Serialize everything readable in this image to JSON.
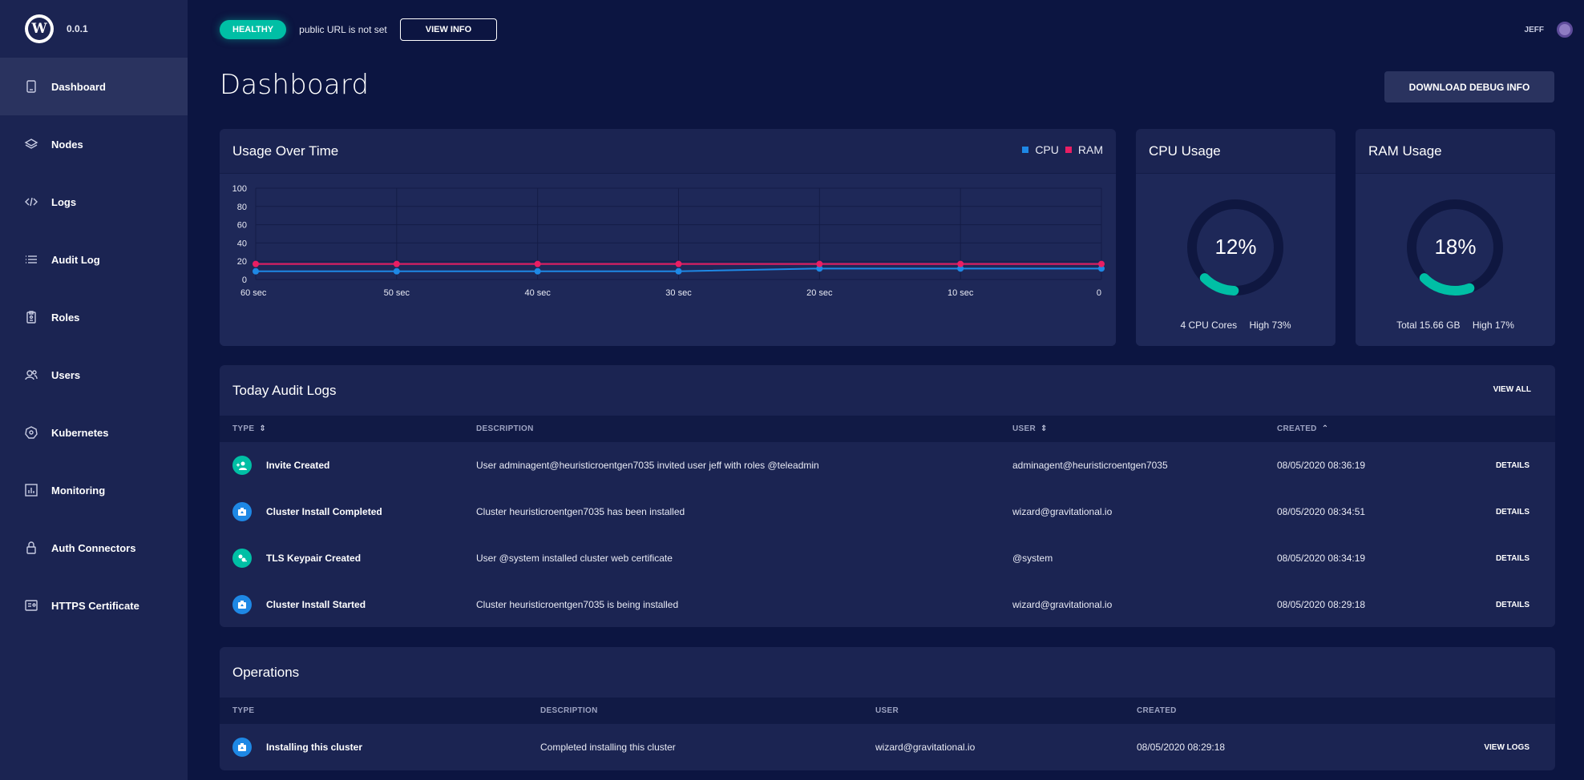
{
  "app": {
    "version": "0.0.1"
  },
  "sidebar": {
    "items": [
      {
        "label": "Dashboard",
        "icon": "tablet-icon"
      },
      {
        "label": "Nodes",
        "icon": "layers-icon"
      },
      {
        "label": "Logs",
        "icon": "code-icon"
      },
      {
        "label": "Audit Log",
        "icon": "list-icon"
      },
      {
        "label": "Roles",
        "icon": "clipboard-icon"
      },
      {
        "label": "Users",
        "icon": "users-icon"
      },
      {
        "label": "Kubernetes",
        "icon": "kubernetes-icon"
      },
      {
        "label": "Monitoring",
        "icon": "bar-chart-icon"
      },
      {
        "label": "Auth Connectors",
        "icon": "lock-icon"
      },
      {
        "label": "HTTPS Certificate",
        "icon": "certificate-icon"
      }
    ]
  },
  "topbar": {
    "status": "HEALTHY",
    "url_text": "public URL is not set",
    "view_info": "VIEW INFO",
    "user": "JEFF"
  },
  "page": {
    "title": "Dashboard",
    "debug_button": "DOWNLOAD DEBUG INFO"
  },
  "usage_card": {
    "title": "Usage Over Time",
    "legend": [
      {
        "name": "CPU",
        "color": "#1e88e5"
      },
      {
        "name": "RAM",
        "color": "#e91e63"
      }
    ]
  },
  "chart_data": {
    "type": "line",
    "x": [
      "60 sec",
      "50 sec",
      "40 sec",
      "30 sec",
      "20 sec",
      "10 sec",
      "0"
    ],
    "series": [
      {
        "name": "CPU",
        "color": "#1e88e5",
        "values": [
          9,
          9,
          9,
          9,
          12,
          12,
          12
        ]
      },
      {
        "name": "RAM",
        "color": "#e91e63",
        "values": [
          17,
          17,
          17,
          17,
          17,
          17,
          17
        ]
      }
    ],
    "yticks": [
      0,
      20,
      40,
      60,
      80,
      100
    ],
    "ylim": [
      0,
      100
    ],
    "grid": true,
    "legend": "top-right"
  },
  "cpu_card": {
    "title": "CPU Usage",
    "value": "12%",
    "percent": 12,
    "cores": "4 CPU Cores",
    "high": "High 73%"
  },
  "ram_card": {
    "title": "RAM Usage",
    "value": "18%",
    "percent": 18,
    "total": "Total 15.66 GB",
    "high": "High 17%"
  },
  "audit": {
    "title": "Today Audit Logs",
    "view_all": "VIEW ALL",
    "columns": {
      "type": "TYPE",
      "description": "DESCRIPTION",
      "user": "USER",
      "created": "CREATED"
    },
    "rows": [
      {
        "type": "Invite Created",
        "icon": "user-add-icon",
        "description": "User adminagent@heuristicroentgen7035 invited user jeff with roles @teleadmin",
        "user": "adminagent@heuristicroentgen7035",
        "created": "08/05/2020 08:36:19",
        "action": "DETAILS"
      },
      {
        "type": "Cluster Install Completed",
        "icon": "cluster-icon",
        "description": "Cluster heuristicroentgen7035 has been installed",
        "user": "wizard@gravitational.io",
        "created": "08/05/2020 08:34:51",
        "action": "DETAILS"
      },
      {
        "type": "TLS Keypair Created",
        "icon": "keypair-icon",
        "description": "User @system installed cluster web certificate",
        "user": "@system",
        "created": "08/05/2020 08:34:19",
        "action": "DETAILS"
      },
      {
        "type": "Cluster Install Started",
        "icon": "cluster-icon",
        "description": "Cluster heuristicroentgen7035 is being installed",
        "user": "wizard@gravitational.io",
        "created": "08/05/2020 08:29:18",
        "action": "DETAILS"
      }
    ]
  },
  "operations": {
    "title": "Operations",
    "columns": {
      "type": "TYPE",
      "description": "DESCRIPTION",
      "user": "USER",
      "created": "CREATED"
    },
    "rows": [
      {
        "type": "Installing this cluster",
        "icon": "cluster-icon",
        "description": "Completed installing this cluster",
        "user": "wizard@gravitational.io",
        "created": "08/05/2020 08:29:18",
        "action": "VIEW LOGS"
      }
    ]
  },
  "colors": {
    "accent": "#00bfa5",
    "cluster_icon": "#1e88e5",
    "teal_icon": "#00bfa5"
  }
}
